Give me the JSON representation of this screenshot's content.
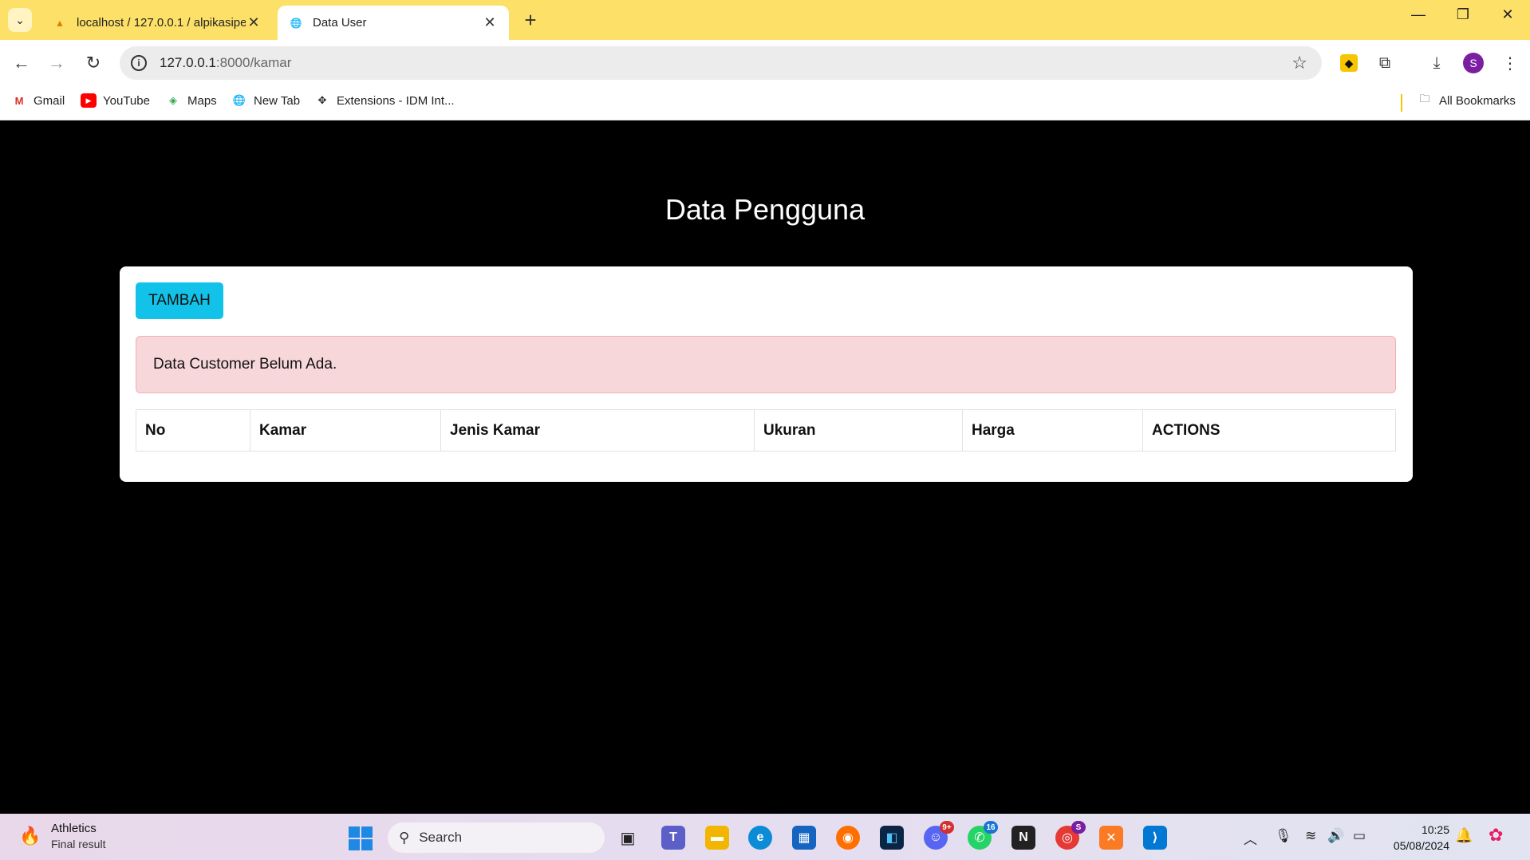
{
  "browser": {
    "tabs": [
      {
        "title": "localhost / 127.0.0.1 / alpikasipe",
        "favicon": "phpmyadmin-icon"
      },
      {
        "title": "Data User",
        "favicon": "globe-icon"
      }
    ],
    "url_host": "127.0.0.1",
    "url_rest": ":8000/kamar",
    "bookmarks": [
      {
        "label": "Gmail",
        "icon": "gmail-icon"
      },
      {
        "label": "YouTube",
        "icon": "youtube-icon"
      },
      {
        "label": "Maps",
        "icon": "maps-icon"
      },
      {
        "label": "New Tab",
        "icon": "globe-icon"
      },
      {
        "label": "Extensions - IDM Int...",
        "icon": "puzzle-icon"
      }
    ],
    "all_bookmarks": "All Bookmarks",
    "profile_initial": "S"
  },
  "page": {
    "heading": "Data Pengguna",
    "add_button": "TAMBAH",
    "alert": "Data Customer Belum Ada.",
    "columns": [
      "No",
      "Kamar",
      "Jenis Kamar",
      "Ukuran",
      "Harga",
      "ACTIONS"
    ]
  },
  "taskbar": {
    "weather_title": "Athletics",
    "weather_sub": "Final result",
    "search_placeholder": "Search",
    "time": "10:25",
    "date": "05/08/2024",
    "badges": {
      "discord": "9+",
      "whatsapp": "16",
      "chrome": "S"
    }
  },
  "colors": {
    "tabbar": "#fde068",
    "button": "#13c2e8",
    "alert_bg": "#f8d7da",
    "page_bg": "#000000"
  }
}
